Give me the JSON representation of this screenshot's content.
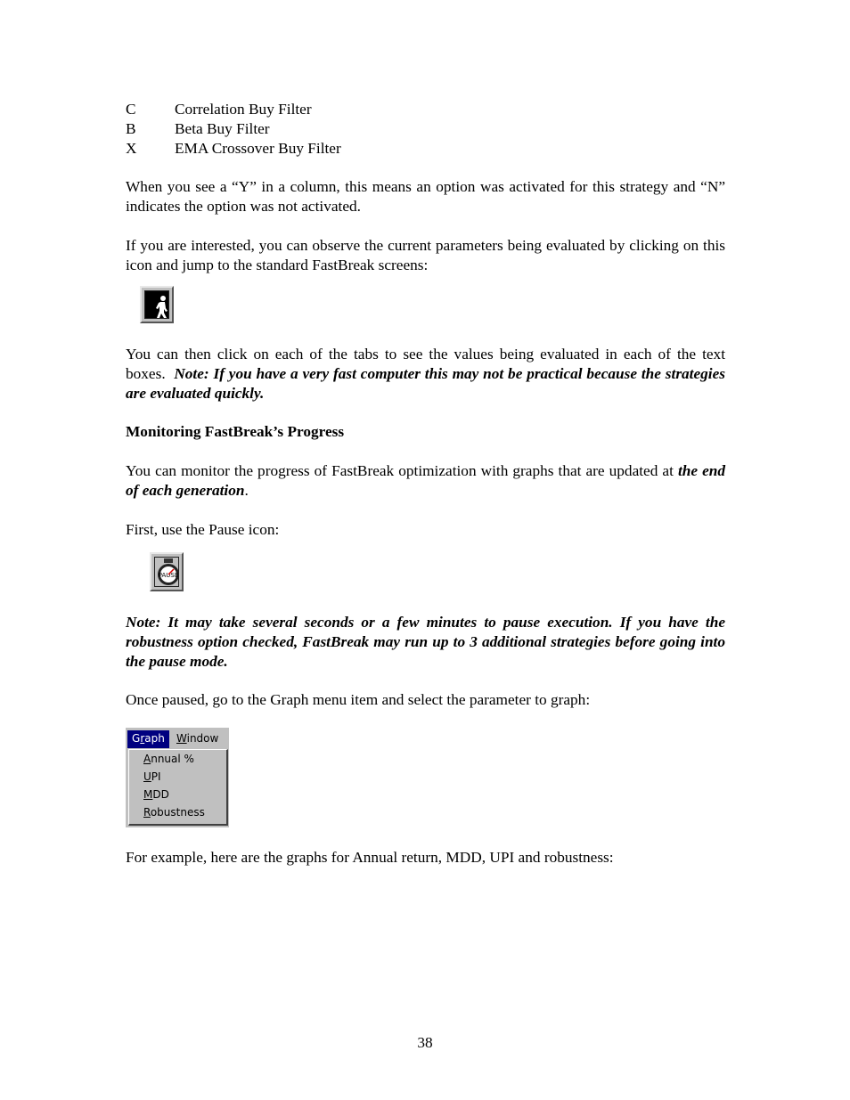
{
  "legend": [
    {
      "key": "C",
      "label": "Correlation Buy Filter"
    },
    {
      "key": "B",
      "label": "Beta Buy Filter"
    },
    {
      "key": "X",
      "label": "EMA Crossover Buy Filter"
    }
  ],
  "paragraphs": {
    "yn_explain": "When you see a “Y” in a column, this means an option was activated for this strategy and “N” indicates the option was not activated.",
    "observe_params": "If you are interested, you can observe the current parameters being evaluated by clicking on this icon and jump to the standard FastBreak screens:",
    "tabs_text": "You can then click on each of the tabs to see the values being evaluated in each of the text boxes.",
    "tabs_note": "Note:  If you have a very fast computer this may not be practical because the strategies are evaluated quickly.",
    "monitor_text": "You can monitor the progress of FastBreak optimization with graphs that are updated at ",
    "monitor_emph": "the end of each generation",
    "monitor_end": ".",
    "pause_intro": "First, use the Pause icon:",
    "pause_note": "Note: It may take several seconds or a few minutes to pause execution.  If you have the robustness option checked, FastBreak may run up to 3 additional strategies before going into the pause mode.",
    "graph_menu_intro": "Once paused, go to the Graph menu item and select the parameter to graph:",
    "example_graphs": "For example, here are the graphs for Annual return, MDD, UPI and robustness:"
  },
  "section_heading": "Monitoring FastBreak’s Progress",
  "icons": {
    "fastbreak_screens": "running-man-icon",
    "pause": "stopwatch-icon"
  },
  "menu": {
    "bar": [
      {
        "pre": "G",
        "ul": "r",
        "post": "aph",
        "active": true
      },
      {
        "pre": "",
        "ul": "W",
        "post": "indow",
        "active": false
      }
    ],
    "items": [
      {
        "pre": "",
        "ul": "A",
        "post": "nnual %"
      },
      {
        "pre": "",
        "ul": "U",
        "post": "PI"
      },
      {
        "pre": "",
        "ul": "M",
        "post": "DD"
      },
      {
        "pre": "",
        "ul": "R",
        "post": "obustness"
      }
    ]
  },
  "page_number": "38"
}
